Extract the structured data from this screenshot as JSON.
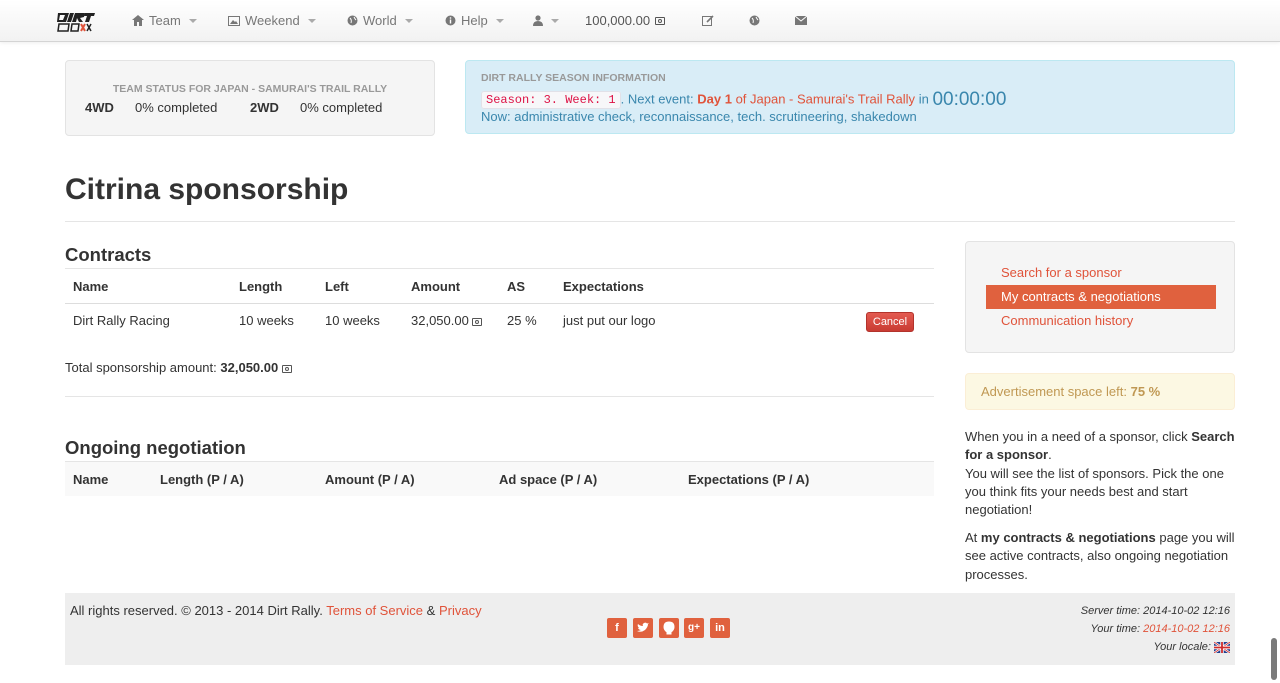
{
  "nav": {
    "team_label": "Team",
    "weekend_label": "Weekend",
    "world_label": "World",
    "help_label": "Help",
    "balance": "100,000.00"
  },
  "team_status": {
    "title": "TEAM STATUS FOR JAPAN - SAMURAI'S TRAIL RALLY",
    "awd_label": "4WD",
    "awd_value": "0% completed",
    "twd_label": "2WD",
    "twd_value": "0% completed"
  },
  "season": {
    "title": "DIRT RALLY SEASON INFORMATION",
    "code": "Season: 3. Week: 1",
    "next_event_prefix": ". Next event:",
    "day": "Day 1",
    "event_text": "of Japan - Samurai's Trail Rally",
    "in_label": "in",
    "timer": "00:00:00",
    "now": "Now: administrative check, reconnaissance, tech. scrutineering, shakedown"
  },
  "page_title": "Citrina sponsorship",
  "contracts": {
    "heading": "Contracts",
    "headers": [
      "Name",
      "Length",
      "Left",
      "Amount",
      "AS",
      "Expectations"
    ],
    "rows": [
      {
        "name": "Dirt Rally Racing",
        "length": "10 weeks",
        "left": "10 weeks",
        "amount": "32,050.00",
        "as": "25 %",
        "expectations": "just put our logo",
        "action": "Cancel"
      }
    ],
    "total_label": "Total sponsorship amount:",
    "total_value": "32,050.00"
  },
  "negotiation": {
    "heading": "Ongoing negotiation",
    "headers": [
      "Name",
      "Length (P / A)",
      "Amount (P / A)",
      "Ad space (P / A)",
      "Expectations (P / A)"
    ]
  },
  "sidebar": {
    "links": [
      "Search for a sponsor",
      "My contracts & negotiations",
      "Communication history"
    ],
    "active_index": 1,
    "ad_label": "Advertisement space left:",
    "ad_value": "75 %",
    "help1_a": "When you in a need of a sponsor, click",
    "help1_b": "Search for a sponsor",
    "help1_c": ".",
    "help1_d": "You will see the list of sponsors. Pick the one you think fits your needs best and start negotiation!",
    "help2_a": "At",
    "help2_b": "my contracts & negotiations",
    "help2_c": "page you will see active contracts, also ongoing negotiation processes."
  },
  "footer": {
    "rights": "All rights reserved. © 2013 - 2014 Dirt Rally.",
    "tos": "Terms of Service",
    "amp": "&",
    "privacy": "Privacy",
    "server_label": "Server time:",
    "server_time": "2014-10-02 12:16",
    "your_label": "Your time:",
    "your_time": "2014-10-02 12:16",
    "locale_label": "Your locale:",
    "social": [
      "facebook-icon",
      "twitter-icon",
      "github-icon",
      "google-plus-icon",
      "linkedin-icon"
    ]
  },
  "colors": {
    "accent": "#e0533a",
    "active_bg": "#e0613e",
    "info_text": "#3a87ad",
    "danger": "#c93b33"
  }
}
